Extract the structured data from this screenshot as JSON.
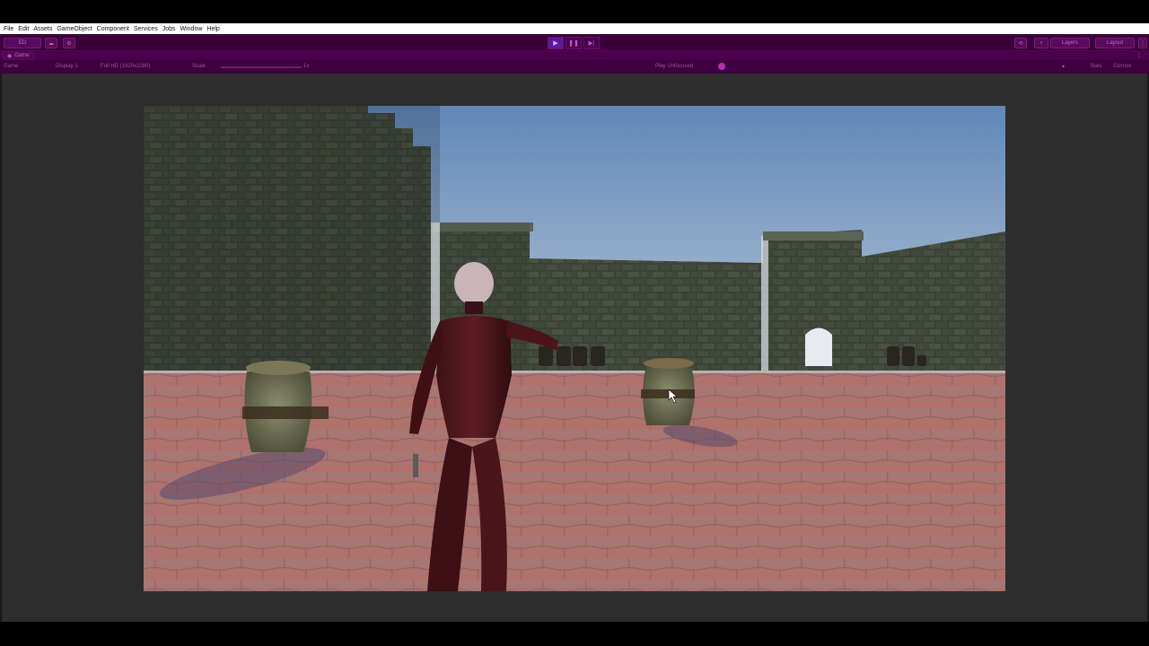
{
  "menu": {
    "items": [
      "File",
      "Edit",
      "Assets",
      "GameObject",
      "Component",
      "Services",
      "Jobs",
      "Window",
      "Help"
    ]
  },
  "toolbar": {
    "account_label": "ED",
    "play_icon": "play-icon",
    "pause_icon": "pause-icon",
    "step_icon": "step-icon",
    "layers_label": "Layers",
    "layout_label": "Layout"
  },
  "game_tab": {
    "label": "Game"
  },
  "game_bar": {
    "view_select": "Game",
    "display_select": "Display 1",
    "resolution_select": "Full HD (1920x1080)",
    "scale_label": "Scale",
    "scale_value": "1x",
    "play_mode_select": "Play Unfocused",
    "stats_label": "Stats",
    "gizmos_label": "Gizmos"
  },
  "colors": {
    "theme_purple": "#3a003a",
    "menubar_bg": "#ffffff",
    "panel_bg": "#2d2d2d"
  }
}
